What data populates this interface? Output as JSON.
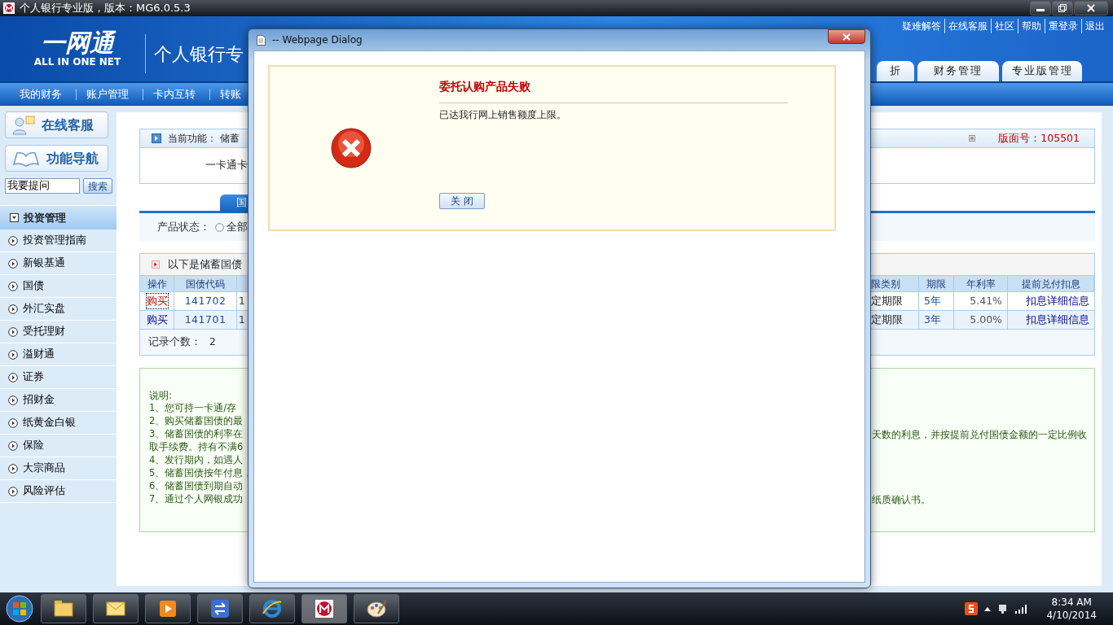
{
  "window": {
    "title": "个人银行专业版，版本：MG6.0.5.3"
  },
  "banner": {
    "logo_text": "一网通",
    "logo_subtitle": "ALL IN ONE NET",
    "product_title": "个人银行专",
    "top_links": [
      "疑难解答",
      "在线客服",
      "社区",
      "帮助",
      "重登录",
      "退出"
    ],
    "tabs": [
      "折",
      "财务管理",
      "专业版管理"
    ]
  },
  "nav": [
    "我的财务",
    "账户管理",
    "卡内互转",
    "转账"
  ],
  "sidebar": {
    "buttons": [
      "在线客服",
      "功能导航"
    ],
    "search": {
      "value": "我要提问",
      "button": "搜索"
    },
    "section": {
      "label": "投资管理",
      "expanded": true,
      "items": [
        "投资管理指南",
        "新银基通",
        "国债",
        "外汇实盘",
        "受托理财",
        "溢财通",
        "证券",
        "招财金",
        "纸黄金白银",
        "保险",
        "大宗商品",
        "风险评估"
      ]
    }
  },
  "content": {
    "current_function": {
      "label": "当前功能：",
      "value": "储蓄"
    },
    "page_number": {
      "label": "版面号：",
      "value": "105501"
    },
    "card_text": "一卡通卡",
    "tab": "国",
    "filter": {
      "label": "产品状态：",
      "options": [
        {
          "label": "全部",
          "selected": false
        }
      ]
    },
    "list_title": "以下是储蓄国债",
    "table": {
      "columns_left": [
        "操作",
        "国债代码"
      ],
      "columns_right": [
        "限类别",
        "期限",
        "年利率",
        "提前兑付扣息"
      ],
      "rows": [
        {
          "action": "购买",
          "focused": true,
          "code": "141702",
          "column_3": "1",
          "term_type": "定期限",
          "term": "5年",
          "rate": "5.41%",
          "link": "扣息详细信息"
        },
        {
          "action": "购买",
          "focused": false,
          "code": "141701",
          "column_3": "1",
          "term_type": "定期限",
          "term": "3年",
          "rate": "5.00%",
          "link": "扣息详细信息"
        }
      ]
    },
    "record_count": {
      "label": "记录个数：",
      "value": "2"
    },
    "notes": {
      "title": "说明:",
      "lines": [
        {
          "left": "1、您可持一卡通/存"
        },
        {
          "left": "2、购买储蓄国债的最"
        },
        {
          "left": "3、储蓄国债的利率在",
          "right": "天数的利息，并按提前兑付国债金额的一定比例收"
        },
        {
          "left": "取手续费。持有不满6"
        },
        {
          "left": "4、发行期内，如遇人"
        },
        {
          "left": "5、储蓄国债按年付息，"
        },
        {
          "left": "6、储蓄国债到期自动"
        },
        {
          "left": "7、通过个人网银成功",
          "right": "纸质确认书。"
        }
      ]
    }
  },
  "dialog": {
    "title": "-- Webpage Dialog",
    "heading": "委托认购产品失败",
    "message": "已达我行网上销售额度上限。",
    "button": "关 闭"
  },
  "taskbar": {
    "clock": {
      "time": "8:34 AM",
      "date": "4/10/2014"
    }
  }
}
